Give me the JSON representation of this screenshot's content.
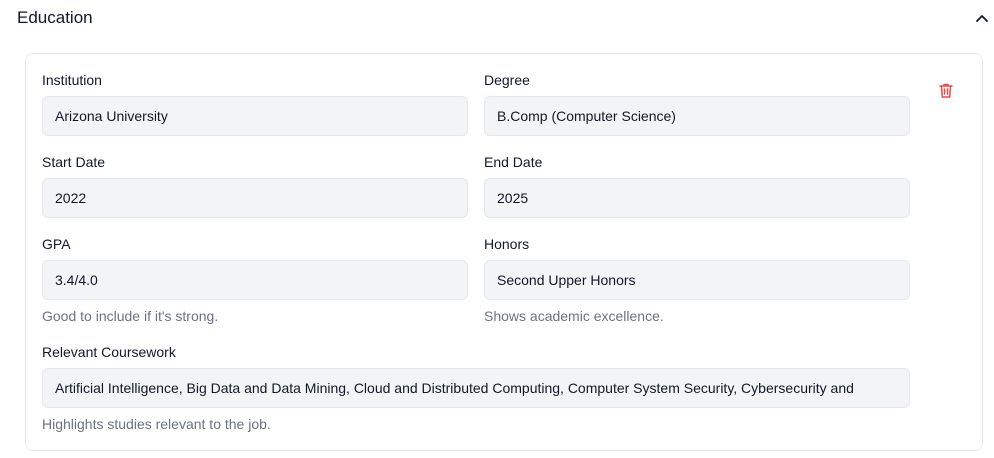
{
  "section": {
    "title": "Education"
  },
  "entry": {
    "institution": {
      "label": "Institution",
      "value": "Arizona University"
    },
    "degree": {
      "label": "Degree",
      "value": "B.Comp (Computer Science)"
    },
    "start_date": {
      "label": "Start Date",
      "value": "2022"
    },
    "end_date": {
      "label": "End Date",
      "value": "2025"
    },
    "gpa": {
      "label": "GPA",
      "value": "3.4/4.0",
      "hint": "Good to include if it's strong."
    },
    "honors": {
      "label": "Honors",
      "value": "Second Upper Honors",
      "hint": "Shows academic excellence."
    },
    "coursework": {
      "label": "Relevant Coursework",
      "value": "Artificial Intelligence, Big Data and Data Mining, Cloud and Distributed Computing, Computer System Security, Cybersecurity and",
      "hint": "Highlights studies relevant to the job."
    }
  },
  "icons": {
    "collapse": "chevron-up-icon",
    "delete": "trash-icon"
  },
  "colors": {
    "delete_accent": "#ef4444",
    "input_bg": "#f3f4f6",
    "hint_text": "#6b7280"
  }
}
